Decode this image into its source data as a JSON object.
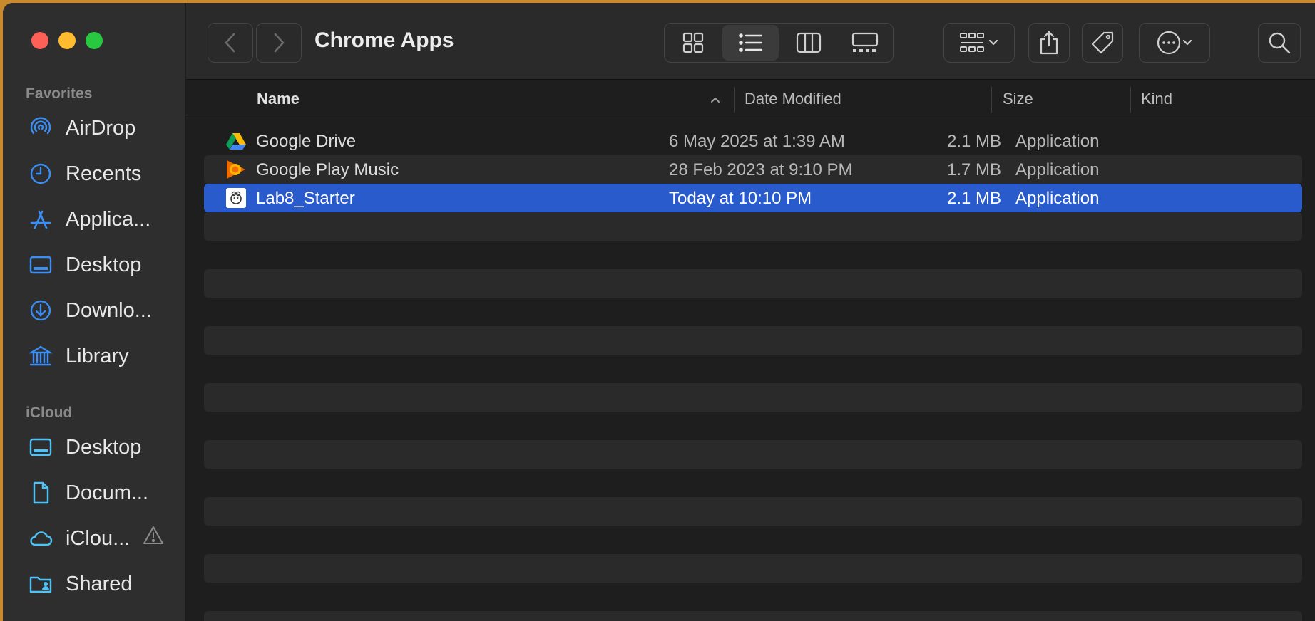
{
  "window": {
    "title": "Chrome Apps"
  },
  "sidebar": {
    "favorites_label": "Favorites",
    "favorites": [
      {
        "label": "AirDrop",
        "icon": "airdrop-icon"
      },
      {
        "label": "Recents",
        "icon": "clock-icon"
      },
      {
        "label": "Applica...",
        "icon": "applications-icon"
      },
      {
        "label": "Desktop",
        "icon": "desktop-icon"
      },
      {
        "label": "Downlo...",
        "icon": "download-icon"
      },
      {
        "label": "Library",
        "icon": "library-icon"
      }
    ],
    "icloud_label": "iCloud",
    "icloud": [
      {
        "label": "Desktop",
        "icon": "desktop-icon"
      },
      {
        "label": "Docum...",
        "icon": "document-icon"
      },
      {
        "label": "iClou...",
        "icon": "cloud-icon",
        "badge": "warning-icon"
      },
      {
        "label": "Shared",
        "icon": "shared-folder-icon"
      }
    ]
  },
  "columns": {
    "name": "Name",
    "date": "Date Modified",
    "size": "Size",
    "kind": "Kind",
    "sort": "ascending"
  },
  "files": [
    {
      "name": "Google Drive",
      "date": "6 May 2025 at 1:39 AM",
      "size": "2.1 MB",
      "kind": "Application",
      "icon": "google-drive-icon"
    },
    {
      "name": "Google Play Music",
      "date": "28 Feb 2023 at 9:10 PM",
      "size": "1.7 MB",
      "kind": "Application",
      "icon": "google-play-music-icon"
    },
    {
      "name": "Lab8_Starter",
      "date": "Today at 10:10 PM",
      "size": "2.1 MB",
      "kind": "Application",
      "icon": "lab8-app-icon",
      "selected": true
    }
  ],
  "colors": {
    "accent": "#2a5bcc",
    "sidebar_icon": "#3a8ef6",
    "icloud_icon": "#4fc3f7"
  }
}
